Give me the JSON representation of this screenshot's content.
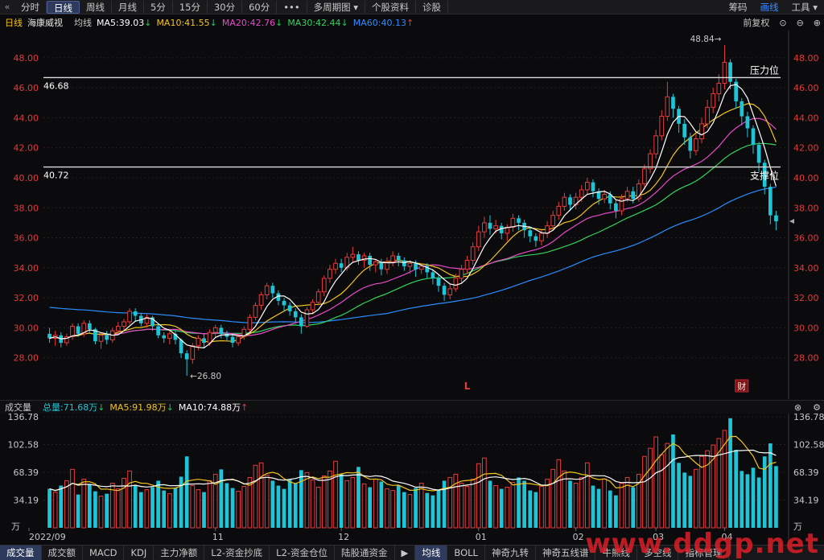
{
  "toolbar": {
    "back_icon": "double-chevron-left-icon",
    "tabs": [
      {
        "label": "分时",
        "active": false
      },
      {
        "label": "日线",
        "active": true
      },
      {
        "label": "周线",
        "active": false
      },
      {
        "label": "月线",
        "active": false
      },
      {
        "label": "5分",
        "active": false
      },
      {
        "label": "15分",
        "active": false
      },
      {
        "label": "30分",
        "active": false
      },
      {
        "label": "60分",
        "active": false
      },
      {
        "label": "•••",
        "active": false
      },
      {
        "label": "多周期图 ▾",
        "active": false
      },
      {
        "label": "个股资料",
        "active": false
      },
      {
        "label": "诊股",
        "active": false
      }
    ],
    "right": [
      "筹码",
      "画线",
      "工具 ▾"
    ]
  },
  "info": {
    "period": "日线",
    "stock_name": "海康威视",
    "avg_line": "均线",
    "ma5": "MA5:39.03",
    "ma10": "MA10:41.55",
    "ma20": "MA20:42.76",
    "ma30": "MA30:42.44",
    "ma60": "MA60:40.13",
    "adjust": "前复权"
  },
  "colors": {
    "up": "#e83b3b",
    "down": "#1ec5d6",
    "ma5": "#ffffff",
    "ma10": "#f2c318",
    "ma20": "#e74ac9",
    "ma30": "#33d35d",
    "ma60": "#2a8cff",
    "axis_text": "#e23a3a",
    "grid": "#2a1e1e"
  },
  "chart_data": {
    "type": "candlestick",
    "y_ticks": [
      "48.00",
      "46.00",
      "44.00",
      "42.00",
      "40.00",
      "38.00",
      "36.00",
      "34.00",
      "32.00",
      "30.00",
      "28.00"
    ],
    "ylim": [
      26.0,
      49.6
    ],
    "annotations": {
      "high_label": "48.84→",
      "low_label": "←26.80",
      "resistance_price": "46.68",
      "resistance_label": "压力位",
      "support_price": "40.72",
      "support_label": "支撑位",
      "marker_l": "L",
      "marker_cai": "财"
    },
    "ma60_start": 31.4,
    "candles": [
      [
        29.6,
        29.3,
        30.0,
        29.0
      ],
      [
        29.3,
        29.5,
        29.8,
        28.8
      ],
      [
        29.5,
        29.0,
        29.7,
        28.7
      ],
      [
        29.0,
        29.4,
        29.6,
        28.8
      ],
      [
        29.4,
        30.1,
        30.3,
        29.2
      ],
      [
        30.1,
        29.6,
        30.3,
        29.4
      ],
      [
        29.6,
        30.3,
        30.5,
        29.4
      ],
      [
        30.3,
        29.9,
        30.5,
        29.6
      ],
      [
        29.9,
        29.1,
        30.0,
        28.9
      ],
      [
        29.1,
        29.5,
        29.7,
        28.6
      ],
      [
        29.5,
        29.2,
        29.8,
        28.9
      ],
      [
        29.2,
        29.8,
        30.0,
        29.0
      ],
      [
        29.8,
        30.1,
        30.4,
        29.6
      ],
      [
        30.1,
        30.4,
        30.6,
        29.8
      ],
      [
        30.4,
        31.1,
        31.3,
        30.2
      ],
      [
        31.1,
        30.8,
        31.3,
        30.4
      ],
      [
        30.8,
        30.3,
        31.0,
        30.1
      ],
      [
        30.3,
        30.7,
        30.9,
        30.0
      ],
      [
        30.7,
        30.1,
        30.8,
        29.8
      ],
      [
        30.1,
        29.5,
        30.3,
        29.3
      ],
      [
        29.5,
        29.3,
        29.7,
        29.0
      ],
      [
        29.3,
        29.6,
        29.9,
        28.9
      ],
      [
        29.6,
        29.2,
        29.8,
        28.9
      ],
      [
        29.2,
        28.3,
        29.3,
        28.0
      ],
      [
        28.3,
        27.9,
        28.5,
        26.8
      ],
      [
        27.9,
        28.8,
        29.0,
        27.6
      ],
      [
        28.8,
        29.3,
        29.5,
        28.5
      ],
      [
        29.3,
        29.0,
        29.6,
        28.7
      ],
      [
        29.0,
        29.7,
        29.9,
        28.8
      ],
      [
        29.7,
        30.0,
        30.2,
        29.4
      ],
      [
        30.0,
        29.6,
        30.2,
        29.3
      ],
      [
        29.6,
        29.4,
        29.8,
        29.1
      ],
      [
        29.4,
        29.0,
        29.6,
        28.7
      ],
      [
        29.0,
        29.4,
        29.6,
        28.8
      ],
      [
        29.4,
        29.9,
        30.1,
        29.2
      ],
      [
        29.9,
        30.7,
        30.9,
        29.7
      ],
      [
        30.7,
        31.5,
        31.7,
        30.5
      ],
      [
        31.5,
        32.2,
        32.4,
        31.2
      ],
      [
        32.2,
        32.8,
        33.0,
        31.9
      ],
      [
        32.8,
        32.3,
        33.0,
        32.0
      ],
      [
        32.3,
        31.8,
        32.5,
        31.5
      ],
      [
        31.8,
        31.5,
        32.0,
        31.1
      ],
      [
        31.5,
        31.1,
        31.7,
        30.8
      ],
      [
        31.1,
        30.7,
        31.3,
        30.4
      ],
      [
        30.7,
        30.1,
        30.9,
        29.6
      ],
      [
        30.1,
        31.2,
        31.4,
        30.0
      ],
      [
        31.2,
        31.7,
        31.9,
        30.9
      ],
      [
        31.7,
        32.4,
        32.6,
        31.5
      ],
      [
        32.4,
        33.3,
        33.5,
        32.1
      ],
      [
        33.3,
        33.9,
        34.2,
        33.0
      ],
      [
        33.9,
        34.3,
        34.6,
        33.6
      ],
      [
        34.3,
        34.0,
        34.6,
        33.7
      ],
      [
        34.0,
        34.7,
        35.0,
        33.8
      ],
      [
        34.7,
        34.9,
        35.4,
        34.4
      ],
      [
        34.9,
        34.5,
        35.1,
        34.2
      ],
      [
        34.5,
        34.8,
        35.0,
        34.0
      ],
      [
        34.8,
        34.2,
        35.0,
        33.8
      ],
      [
        34.2,
        34.4,
        34.6,
        33.7
      ],
      [
        34.4,
        33.9,
        34.6,
        33.5
      ],
      [
        33.9,
        34.4,
        34.7,
        33.6
      ],
      [
        34.4,
        34.8,
        35.1,
        34.1
      ],
      [
        34.8,
        34.5,
        35.0,
        34.1
      ],
      [
        34.5,
        34.1,
        34.7,
        33.8
      ],
      [
        34.1,
        34.3,
        34.5,
        33.6
      ],
      [
        34.3,
        33.9,
        34.5,
        33.4
      ],
      [
        33.9,
        34.1,
        34.3,
        33.6
      ],
      [
        34.1,
        33.7,
        34.3,
        33.3
      ],
      [
        33.7,
        33.3,
        33.9,
        32.9
      ],
      [
        33.3,
        32.8,
        33.5,
        32.4
      ],
      [
        32.8,
        32.2,
        33.0,
        31.8
      ],
      [
        32.2,
        32.6,
        32.9,
        31.9
      ],
      [
        32.6,
        33.3,
        33.6,
        32.4
      ],
      [
        33.3,
        33.9,
        34.2,
        33.0
      ],
      [
        33.9,
        34.5,
        34.8,
        33.6
      ],
      [
        34.5,
        35.4,
        35.7,
        34.2
      ],
      [
        35.4,
        36.4,
        36.8,
        35.1
      ],
      [
        36.4,
        37.0,
        37.4,
        36.0
      ],
      [
        37.0,
        36.6,
        37.5,
        36.2
      ],
      [
        36.6,
        36.8,
        37.2,
        36.3
      ],
      [
        36.8,
        36.3,
        37.0,
        35.9
      ],
      [
        36.3,
        36.7,
        36.9,
        35.8
      ],
      [
        36.7,
        37.3,
        37.6,
        36.4
      ],
      [
        37.3,
        37.0,
        37.5,
        36.5
      ],
      [
        37.0,
        36.5,
        37.2,
        36.0
      ],
      [
        36.5,
        36.1,
        36.7,
        35.7
      ],
      [
        36.1,
        35.8,
        36.3,
        35.4
      ],
      [
        35.8,
        36.3,
        36.5,
        35.5
      ],
      [
        36.3,
        36.8,
        37.1,
        36.0
      ],
      [
        36.8,
        37.5,
        37.8,
        36.5
      ],
      [
        37.5,
        38.1,
        38.4,
        37.2
      ],
      [
        38.1,
        38.7,
        39.0,
        37.8
      ],
      [
        38.7,
        38.2,
        38.9,
        37.8
      ],
      [
        38.2,
        38.7,
        39.0,
        37.9
      ],
      [
        38.7,
        39.2,
        39.5,
        38.4
      ],
      [
        39.2,
        39.7,
        40.0,
        38.9
      ],
      [
        39.7,
        39.1,
        39.9,
        38.7
      ],
      [
        39.1,
        38.6,
        39.3,
        38.2
      ],
      [
        38.6,
        38.9,
        39.2,
        38.3
      ],
      [
        38.9,
        38.3,
        39.1,
        37.9
      ],
      [
        38.3,
        37.8,
        38.5,
        37.3
      ],
      [
        37.8,
        38.6,
        38.9,
        37.5
      ],
      [
        38.6,
        39.1,
        39.4,
        38.4
      ],
      [
        39.1,
        38.6,
        39.4,
        38.3
      ],
      [
        38.6,
        39.6,
        39.9,
        38.4
      ],
      [
        39.6,
        40.6,
        40.9,
        39.3
      ],
      [
        40.6,
        41.6,
        41.9,
        40.3
      ],
      [
        41.6,
        42.8,
        43.2,
        41.3
      ],
      [
        42.8,
        44.1,
        44.5,
        42.5
      ],
      [
        44.1,
        45.4,
        46.4,
        43.8
      ],
      [
        45.4,
        44.6,
        45.6,
        44.0
      ],
      [
        44.6,
        43.6,
        44.8,
        43.0
      ],
      [
        43.6,
        42.7,
        43.9,
        42.2
      ],
      [
        42.7,
        41.8,
        43.0,
        41.3
      ],
      [
        41.8,
        42.6,
        42.9,
        41.5
      ],
      [
        42.6,
        43.6,
        44.0,
        42.3
      ],
      [
        43.6,
        44.7,
        45.2,
        43.3
      ],
      [
        44.7,
        45.6,
        46.0,
        44.3
      ],
      [
        45.6,
        46.3,
        46.9,
        45.1
      ],
      [
        46.3,
        47.7,
        48.84,
        45.9
      ],
      [
        47.7,
        46.4,
        47.9,
        45.9
      ],
      [
        46.4,
        45.1,
        46.6,
        44.6
      ],
      [
        45.1,
        44.1,
        45.3,
        43.5
      ],
      [
        44.1,
        43.3,
        44.4,
        42.7
      ],
      [
        43.3,
        42.2,
        43.5,
        41.6
      ],
      [
        42.2,
        41.0,
        42.4,
        40.4
      ],
      [
        41.0,
        39.4,
        41.2,
        38.9
      ],
      [
        39.4,
        37.5,
        39.6,
        36.9
      ],
      [
        37.5,
        37.1,
        37.8,
        36.5
      ]
    ],
    "volume": {
      "y_ticks": [
        "136.78",
        "102.58",
        "68.39",
        "34.19"
      ],
      "unit": "万",
      "ylim": [
        0,
        136.78
      ],
      "total": "总量:71.68万",
      "ma5": "MA5:91.98万",
      "ma10": "MA10:74.88万",
      "values": [
        48,
        44,
        52,
        58,
        72,
        41,
        60,
        53,
        45,
        39,
        42,
        55,
        48,
        61,
        70,
        52,
        44,
        47,
        50,
        58,
        46,
        42,
        49,
        63,
        88,
        52,
        47,
        44,
        58,
        66,
        72,
        55,
        49,
        45,
        51,
        62,
        77,
        80,
        65,
        58,
        52,
        48,
        60,
        55,
        71,
        68,
        59,
        50,
        64,
        70,
        82,
        66,
        58,
        62,
        75,
        54,
        50,
        60,
        57,
        48,
        46,
        52,
        44,
        41,
        49,
        55,
        43,
        40,
        47,
        58,
        62,
        66,
        55,
        51,
        60,
        79,
        86,
        58,
        52,
        48,
        50,
        56,
        62,
        58,
        46,
        44,
        51,
        60,
        72,
        84,
        70,
        58,
        55,
        62,
        80,
        52,
        48,
        60,
        46,
        40,
        55,
        62,
        50,
        66,
        88,
        98,
        112,
        90,
        104,
        115,
        80,
        68,
        64,
        72,
        88,
        95,
        102,
        110,
        120,
        135,
        96,
        70,
        66,
        74,
        62,
        88,
        104,
        76
      ]
    },
    "x_labels": [
      {
        "label": "2022/09",
        "idx": 0
      },
      {
        "label": "11",
        "idx": 29
      },
      {
        "label": "12",
        "idx": 51
      },
      {
        "label": "01",
        "idx": 75
      },
      {
        "label": "02",
        "idx": 92
      },
      {
        "label": "03",
        "idx": 106
      },
      {
        "label": "04",
        "idx": 118
      }
    ]
  },
  "vol_header": {
    "title": "成交量",
    "settings_icon": "gear-icon",
    "close_icon": "close-icon"
  },
  "bottom_tabs": [
    {
      "label": "成交量",
      "active": true
    },
    {
      "label": "成交额",
      "active": false
    },
    {
      "label": "MACD",
      "active": false
    },
    {
      "label": "KDJ",
      "active": false
    },
    {
      "label": "主力净额",
      "active": false
    },
    {
      "label": "L2-资金抄底",
      "active": false
    },
    {
      "label": "L2-资金仓位",
      "active": false
    },
    {
      "label": "陆股通资金",
      "active": false
    },
    {
      "label": "▶",
      "active": false
    },
    {
      "label": "均线",
      "active": true
    },
    {
      "label": "BOLL",
      "active": false
    },
    {
      "label": "神奇九转",
      "active": false
    },
    {
      "label": "神奇五线谱",
      "active": false
    },
    {
      "label": "牛熊线",
      "active": false
    },
    {
      "label": "多空线",
      "active": false
    },
    {
      "label": "指标管理",
      "active": false
    }
  ],
  "watermark": "www.ddgp.net"
}
